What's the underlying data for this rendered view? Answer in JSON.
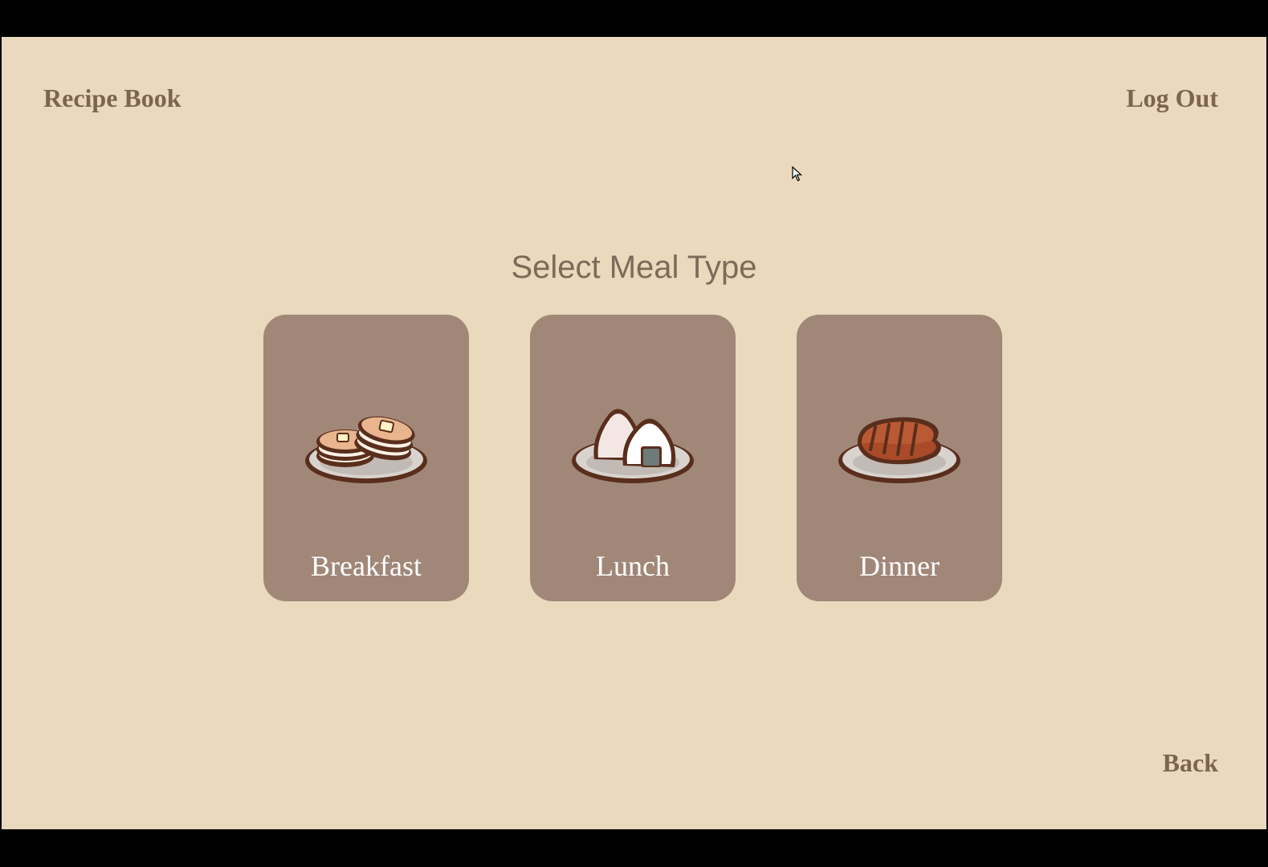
{
  "header": {
    "brand": "Recipe Book",
    "logout_label": "Log Out"
  },
  "main": {
    "title": "Select Meal Type",
    "cards": [
      {
        "label": "Breakfast",
        "icon": "pancakes-icon"
      },
      {
        "label": "Lunch",
        "icon": "onigiri-icon"
      },
      {
        "label": "Dinner",
        "icon": "steak-icon"
      }
    ]
  },
  "footer": {
    "back_label": "Back"
  },
  "colors": {
    "background": "#ead9bd",
    "card": "#a18778",
    "text": "#7d6450",
    "card_text": "#ffffff"
  }
}
